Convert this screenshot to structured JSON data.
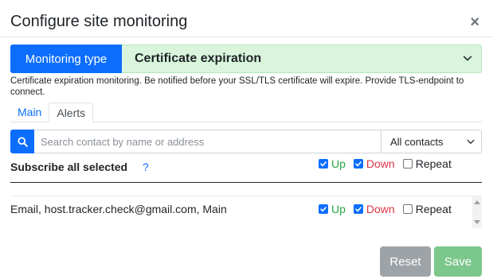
{
  "modal": {
    "title": "Configure site monitoring",
    "close_label": "×"
  },
  "monitoring": {
    "type_label": "Monitoring type",
    "selected_type": "Certificate expiration",
    "description": "Certificate expiration monitoring. Be notified before your SSL/TLS certificate will expire. Provide TLS-endpoint to connect."
  },
  "tabs": [
    {
      "label": "Main"
    },
    {
      "label": "Alerts"
    }
  ],
  "search": {
    "placeholder": "Search contact by name or address",
    "value": "",
    "filter_value": "All contacts"
  },
  "subscribe": {
    "label": "Subscribe all selected",
    "help": "?",
    "up": {
      "label": "Up",
      "checked": true
    },
    "down": {
      "label": "Down",
      "checked": true
    },
    "repeat": {
      "label": "Repeat",
      "checked": false
    }
  },
  "contacts": [
    {
      "text": "Email, host.tracker.check@gmail.com, Main",
      "up": {
        "label": "Up",
        "checked": true
      },
      "down": {
        "label": "Down",
        "checked": true
      },
      "repeat": {
        "label": "Repeat",
        "checked": false
      }
    }
  ],
  "buttons": {
    "reset": "Reset",
    "save": "Save"
  },
  "colors": {
    "primary": "#0d6efd",
    "up": "#28a745",
    "down": "#dc3545",
    "select_bg": "#d9f6dd",
    "reset_bg": "#9ea3a8",
    "save_bg": "#7cc78c"
  }
}
